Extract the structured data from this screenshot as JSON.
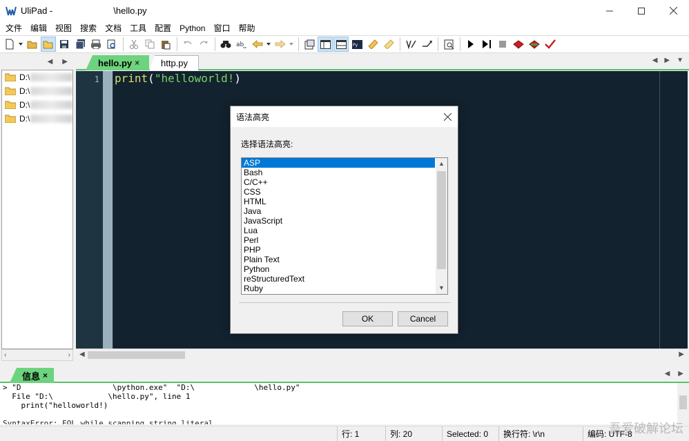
{
  "window": {
    "app_name": "UliPad -",
    "title_path": "\\hello.py",
    "controls": {
      "minimize": "minimize-icon",
      "maximize": "maximize-icon",
      "close": "close-icon"
    }
  },
  "menu": [
    "文件",
    "编辑",
    "视图",
    "搜索",
    "文档",
    "工具",
    "配置",
    "Python",
    "窗口",
    "帮助"
  ],
  "toolbar": {
    "icons": [
      "new-file-icon",
      "open-file-icon",
      "open-folder-icon",
      "save-icon",
      "save-all-icon",
      "print-icon",
      "print-preview-icon",
      "cut-icon",
      "copy-icon",
      "paste-icon",
      "undo-icon",
      "redo-icon",
      "find-icon",
      "replace-icon",
      "back-icon",
      "forward-icon",
      "preferences-icon",
      "panel-left-icon",
      "panel-bottom-icon",
      "python-shell-icon",
      "bookmark-icon",
      "bookmark-next-icon",
      "wrap-icon",
      "goto-icon",
      "doc-view-icon",
      "run-icon",
      "run-args-icon",
      "stop-icon",
      "debug-icon",
      "step-icon",
      "check-icon"
    ]
  },
  "tree": {
    "items": [
      {
        "label": "D:\\"
      },
      {
        "label": "D:\\"
      },
      {
        "label": "D:\\"
      },
      {
        "label": "D:\\"
      }
    ]
  },
  "editor": {
    "tabs": [
      {
        "label": "hello.py",
        "close": "×"
      },
      {
        "label": "http.py"
      }
    ],
    "line_numbers": [
      "1"
    ],
    "code": {
      "fn": "print",
      "open": "(",
      "str": "\"helloworld!",
      "close": ")"
    }
  },
  "bottom": {
    "tab": {
      "label": "信息",
      "close": "×"
    },
    "output_lines": [
      "> \"D                    \\python.exe\"  \"D:\\             \\hello.py\"",
      "  File \"D:\\            \\hello.py\", line 1",
      "    print(\"helloworld!)",
      "",
      "SyntaxError: EOL while scanning string literal"
    ]
  },
  "status": {
    "line": "行: 1",
    "col": "列: 20",
    "selected": "Selected: 0",
    "eol": "换行符: \\r\\n",
    "encoding": "编码: UTF-8"
  },
  "dialog": {
    "title": "语法高亮",
    "prompt": "选择语法高亮:",
    "languages": [
      "ASP",
      "Bash",
      "C/C++",
      "CSS",
      "HTML",
      "Java",
      "JavaScript",
      "Lua",
      "Perl",
      "PHP",
      "Plain Text",
      "Python",
      "reStructuredText",
      "Ruby"
    ],
    "selected": "ASP",
    "ok": "OK",
    "cancel": "Cancel"
  },
  "watermark": "吾爱破解论坛"
}
